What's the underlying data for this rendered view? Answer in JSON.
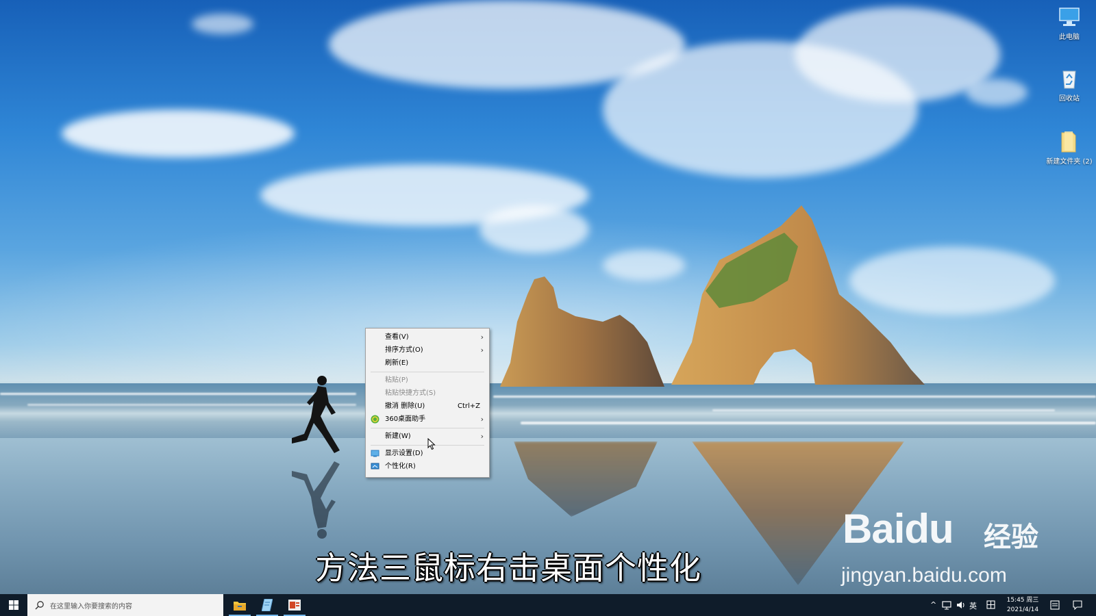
{
  "desktop_icons": [
    {
      "label": "此电脑",
      "icon": "computer-icon"
    },
    {
      "label": "回收站",
      "icon": "recycle-bin-icon"
    },
    {
      "label": "新建文件夹 (2)",
      "icon": "folder-icon"
    }
  ],
  "context_menu": {
    "items": [
      {
        "label": "查看(V)",
        "submenu": true
      },
      {
        "label": "排序方式(O)",
        "submenu": true
      },
      {
        "label": "刷新(E)"
      },
      {
        "label": "粘贴(P)",
        "disabled": true
      },
      {
        "label": "粘贴快捷方式(S)",
        "disabled": true
      },
      {
        "label": "撤消 删除(U)",
        "shortcut": "Ctrl+Z"
      },
      {
        "label": "360桌面助手",
        "submenu": true,
        "icon": "360-icon"
      },
      {
        "label": "新建(W)",
        "submenu": true
      },
      {
        "label": "显示设置(D)",
        "icon": "display-settings-icon"
      },
      {
        "label": "个性化(R)",
        "icon": "personalize-icon"
      }
    ]
  },
  "subtitle": "方法三鼠标右击桌面个性化",
  "watermark": {
    "brand": "Baidu",
    "suffix": "经验",
    "url": "jingyan.baidu.com"
  },
  "taskbar": {
    "search_placeholder": "在这里输入你要搜索的内容",
    "apps": [
      "file-explorer-icon",
      "notepad-icon",
      "powerpoint-icon"
    ],
    "tray": {
      "chevron": "^",
      "ime": "英",
      "time": "15:45 周三",
      "date": "2021/4/14"
    }
  },
  "colors": {
    "taskbar": "#0f1c2a",
    "menu_bg": "#f2f2f2",
    "accent": "#76b9ed"
  }
}
